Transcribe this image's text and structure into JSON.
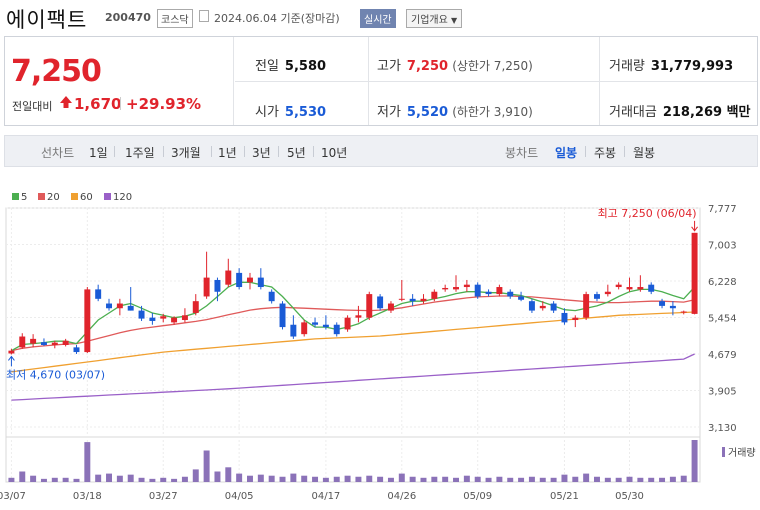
{
  "header": {
    "name": "에이팩트",
    "code": "200470",
    "market": "코스닥",
    "as_of": "2024.06.04 기준(장마감)",
    "realtime": "실시간",
    "company_info": "기업개요"
  },
  "summary": {
    "price": "7,250",
    "change_label": "전일대비",
    "change": "1,670",
    "change_pct": "+29.93%",
    "prev_close_label": "전일",
    "prev_close": "5,580",
    "open_label": "시가",
    "open": "5,530",
    "high_label": "고가",
    "high": "7,250",
    "upper_limit": "(상한가 7,250)",
    "low_label": "저가",
    "low": "5,520",
    "lower_limit": "(하한가 3,910)",
    "volume_label": "거래량",
    "volume": "31,779,993",
    "amount_label": "거래대금",
    "amount": "218,269 백만"
  },
  "toolbar": {
    "line_label": "선차트",
    "periods": [
      "1일",
      "1주일",
      "3개월",
      "1년",
      "3년",
      "5년",
      "10년"
    ],
    "candle_label": "봉차트",
    "candles": [
      "일봉",
      "주봉",
      "월봉"
    ],
    "selected_candle": "일봉"
  },
  "chart_data": {
    "type": "candlestick",
    "legend": [
      {
        "name": "5",
        "color": "#4caf50"
      },
      {
        "name": "20",
        "color": "#e05a5a"
      },
      {
        "name": "60",
        "color": "#f0a030"
      },
      {
        "name": "120",
        "color": "#9a60c8"
      }
    ],
    "y_ticks": [
      7777,
      7003,
      6228,
      5454,
      4679,
      3905,
      3130
    ],
    "y_tick_labels": [
      "7,777",
      "7,003",
      "6,228",
      "5,454",
      "4,679",
      "3,905",
      "3,130"
    ],
    "ylim": [
      3130,
      7777
    ],
    "x_labels": [
      "03/07",
      "03/18",
      "03/27",
      "04/05",
      "04/17",
      "04/26",
      "05/09",
      "05/21",
      "05/30"
    ],
    "x_label_index": [
      0,
      7,
      14,
      21,
      29,
      36,
      43,
      51,
      57
    ],
    "high_annotation": "최고 7,250 (06/04)",
    "low_annotation": "최저 4,670 (03/07)",
    "volume_label": "거래량",
    "candles": [
      {
        "o": 4690,
        "h": 4790,
        "l": 4670,
        "c": 4750
      },
      {
        "o": 4820,
        "h": 5120,
        "l": 4790,
        "c": 5050
      },
      {
        "o": 4900,
        "h": 5100,
        "l": 4820,
        "c": 5000
      },
      {
        "o": 4930,
        "h": 5010,
        "l": 4850,
        "c": 4870
      },
      {
        "o": 4870,
        "h": 4960,
        "l": 4800,
        "c": 4920
      },
      {
        "o": 4870,
        "h": 5000,
        "l": 4840,
        "c": 4960
      },
      {
        "o": 4820,
        "h": 4870,
        "l": 4680,
        "c": 4720
      },
      {
        "o": 4720,
        "h": 6100,
        "l": 4700,
        "c": 6050
      },
      {
        "o": 6050,
        "h": 6150,
        "l": 5800,
        "c": 5850
      },
      {
        "o": 5750,
        "h": 5850,
        "l": 5600,
        "c": 5650
      },
      {
        "o": 5650,
        "h": 5850,
        "l": 5500,
        "c": 5750
      },
      {
        "o": 5700,
        "h": 6100,
        "l": 5600,
        "c": 5600
      },
      {
        "o": 5600,
        "h": 5700,
        "l": 5380,
        "c": 5430
      },
      {
        "o": 5450,
        "h": 5550,
        "l": 5300,
        "c": 5380
      },
      {
        "o": 5430,
        "h": 5530,
        "l": 5350,
        "c": 5480
      },
      {
        "o": 5350,
        "h": 5480,
        "l": 5300,
        "c": 5450
      },
      {
        "o": 5400,
        "h": 5650,
        "l": 5350,
        "c": 5500
      },
      {
        "o": 5550,
        "h": 5950,
        "l": 5500,
        "c": 5800
      },
      {
        "o": 5900,
        "h": 6850,
        "l": 5850,
        "c": 6300
      },
      {
        "o": 6250,
        "h": 6300,
        "l": 5800,
        "c": 6000
      },
      {
        "o": 6150,
        "h": 6700,
        "l": 6100,
        "c": 6450
      },
      {
        "o": 6400,
        "h": 6500,
        "l": 6050,
        "c": 6100
      },
      {
        "o": 6200,
        "h": 6400,
        "l": 6050,
        "c": 6300
      },
      {
        "o": 6300,
        "h": 6500,
        "l": 6050,
        "c": 6100
      },
      {
        "o": 6000,
        "h": 6050,
        "l": 5750,
        "c": 5800
      },
      {
        "o": 5750,
        "h": 5800,
        "l": 5200,
        "c": 5250
      },
      {
        "o": 5300,
        "h": 5500,
        "l": 5000,
        "c": 5050
      },
      {
        "o": 5100,
        "h": 5400,
        "l": 5050,
        "c": 5350
      },
      {
        "o": 5350,
        "h": 5450,
        "l": 5250,
        "c": 5300
      },
      {
        "o": 5300,
        "h": 5500,
        "l": 5200,
        "c": 5250
      },
      {
        "o": 5300,
        "h": 5350,
        "l": 5050,
        "c": 5100
      },
      {
        "o": 5200,
        "h": 5500,
        "l": 5150,
        "c": 5450
      },
      {
        "o": 5450,
        "h": 5700,
        "l": 5350,
        "c": 5500
      },
      {
        "o": 5450,
        "h": 6000,
        "l": 5400,
        "c": 5950
      },
      {
        "o": 5900,
        "h": 5950,
        "l": 5600,
        "c": 5650
      },
      {
        "o": 5600,
        "h": 5800,
        "l": 5550,
        "c": 5750
      },
      {
        "o": 5850,
        "h": 6250,
        "l": 5800,
        "c": 5850
      },
      {
        "o": 5850,
        "h": 5950,
        "l": 5700,
        "c": 5800
      },
      {
        "o": 5800,
        "h": 5950,
        "l": 5750,
        "c": 5850
      },
      {
        "o": 5850,
        "h": 6050,
        "l": 5800,
        "c": 6000
      },
      {
        "o": 6050,
        "h": 6150,
        "l": 6000,
        "c": 6080
      },
      {
        "o": 6050,
        "h": 6350,
        "l": 6000,
        "c": 6100
      },
      {
        "o": 6100,
        "h": 6250,
        "l": 6000,
        "c": 6150
      },
      {
        "o": 6150,
        "h": 6200,
        "l": 5850,
        "c": 5900
      },
      {
        "o": 6000,
        "h": 6050,
        "l": 5900,
        "c": 5950
      },
      {
        "o": 5950,
        "h": 6150,
        "l": 5900,
        "c": 6100
      },
      {
        "o": 6000,
        "h": 6050,
        "l": 5850,
        "c": 5900
      },
      {
        "o": 5900,
        "h": 6000,
        "l": 5800,
        "c": 5830
      },
      {
        "o": 5800,
        "h": 5850,
        "l": 5550,
        "c": 5600
      },
      {
        "o": 5650,
        "h": 5800,
        "l": 5600,
        "c": 5700
      },
      {
        "o": 5750,
        "h": 5800,
        "l": 5550,
        "c": 5600
      },
      {
        "o": 5550,
        "h": 5650,
        "l": 5300,
        "c": 5350
      },
      {
        "o": 5400,
        "h": 5500,
        "l": 5250,
        "c": 5450
      },
      {
        "o": 5450,
        "h": 6000,
        "l": 5400,
        "c": 5950
      },
      {
        "o": 5950,
        "h": 6000,
        "l": 5800,
        "c": 5850
      },
      {
        "o": 5950,
        "h": 6150,
        "l": 5900,
        "c": 6000
      },
      {
        "o": 6100,
        "h": 6200,
        "l": 6050,
        "c": 6150
      },
      {
        "o": 6050,
        "h": 6300,
        "l": 6000,
        "c": 6100
      },
      {
        "o": 6050,
        "h": 6350,
        "l": 6000,
        "c": 6100
      },
      {
        "o": 6150,
        "h": 6200,
        "l": 5950,
        "c": 6000
      },
      {
        "o": 5800,
        "h": 5850,
        "l": 5650,
        "c": 5700
      },
      {
        "o": 5700,
        "h": 5800,
        "l": 5500,
        "c": 5650
      },
      {
        "o": 5580,
        "h": 5600,
        "l": 5520,
        "c": 5580
      },
      {
        "o": 5530,
        "h": 7250,
        "l": 5520,
        "c": 7250
      }
    ],
    "volume": [
      4,
      10,
      6,
      3,
      4,
      4,
      3,
      38,
      7,
      8,
      6,
      7,
      4,
      3,
      4,
      3,
      5,
      12,
      30,
      10,
      14,
      8,
      6,
      7,
      6,
      5,
      8,
      6,
      5,
      4,
      5,
      6,
      5,
      6,
      5,
      4,
      8,
      5,
      4,
      5,
      5,
      4,
      6,
      5,
      4,
      5,
      4,
      4,
      5,
      4,
      4,
      7,
      5,
      8,
      5,
      4,
      4,
      5,
      4,
      4,
      4,
      5,
      6,
      40
    ],
    "ma5": [
      4750,
      4880,
      4900,
      4920,
      4950,
      4950,
      4900,
      5150,
      5400,
      5550,
      5700,
      5750,
      5650,
      5550,
      5500,
      5450,
      5480,
      5550,
      5700,
      5900,
      6100,
      6200,
      6200,
      6150,
      6100,
      5900,
      5650,
      5400,
      5250,
      5250,
      5200,
      5250,
      5320,
      5450,
      5550,
      5650,
      5750,
      5800,
      5800,
      5850,
      5900,
      5960,
      6000,
      6000,
      5980,
      5980,
      5950,
      5920,
      5850,
      5780,
      5700,
      5620,
      5600,
      5650,
      5700,
      5780,
      5900,
      6000,
      6050,
      6050,
      6000,
      5920,
      5850,
      6100
    ],
    "ma20": [
      4750,
      4800,
      4830,
      4850,
      4870,
      4890,
      4900,
      4950,
      5010,
      5070,
      5130,
      5180,
      5220,
      5250,
      5280,
      5310,
      5340,
      5370,
      5410,
      5460,
      5510,
      5560,
      5610,
      5640,
      5660,
      5670,
      5660,
      5650,
      5640,
      5630,
      5620,
      5610,
      5605,
      5600,
      5610,
      5630,
      5660,
      5700,
      5740,
      5780,
      5810,
      5840,
      5870,
      5890,
      5900,
      5910,
      5910,
      5900,
      5890,
      5870,
      5850,
      5830,
      5810,
      5790,
      5780,
      5770,
      5770,
      5780,
      5790,
      5800,
      5800,
      5790,
      5780,
      5830
    ],
    "ma60": [
      4300,
      4330,
      4360,
      4390,
      4420,
      4450,
      4480,
      4510,
      4540,
      4570,
      4600,
      4630,
      4660,
      4690,
      4720,
      4740,
      4760,
      4780,
      4800,
      4820,
      4840,
      4860,
      4880,
      4900,
      4920,
      4940,
      4960,
      4980,
      5000,
      5010,
      5020,
      5030,
      5040,
      5050,
      5060,
      5080,
      5100,
      5120,
      5140,
      5160,
      5180,
      5200,
      5220,
      5240,
      5260,
      5280,
      5300,
      5320,
      5340,
      5360,
      5380,
      5400,
      5420,
      5440,
      5460,
      5480,
      5500,
      5510,
      5520,
      5530,
      5540,
      5550,
      5560,
      5570
    ],
    "ma120": [
      3700,
      3712,
      3724,
      3736,
      3748,
      3760,
      3772,
      3784,
      3796,
      3808,
      3820,
      3832,
      3844,
      3856,
      3868,
      3880,
      3892,
      3904,
      3916,
      3928,
      3940,
      3955,
      3970,
      3985,
      4000,
      4015,
      4030,
      4045,
      4060,
      4075,
      4090,
      4105,
      4120,
      4135,
      4150,
      4165,
      4180,
      4195,
      4210,
      4225,
      4240,
      4255,
      4270,
      4285,
      4300,
      4315,
      4330,
      4345,
      4360,
      4375,
      4390,
      4405,
      4420,
      4435,
      4450,
      4465,
      4480,
      4495,
      4510,
      4525,
      4540,
      4555,
      4570,
      4680
    ]
  }
}
